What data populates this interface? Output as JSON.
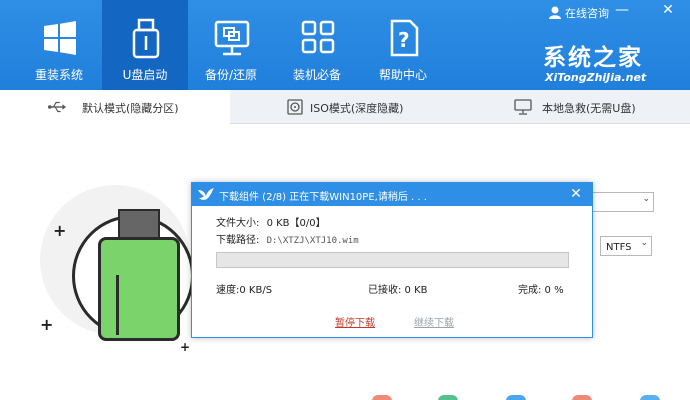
{
  "window": {
    "consult_label": "在线咨询",
    "minimize_label": "—",
    "close_label": "✕"
  },
  "brand": {
    "name_cn": "系统之家",
    "name_en": "XiTongZhiJia.net"
  },
  "nav": [
    {
      "label": "重装系统",
      "icon": "windows-logo-icon",
      "active": false
    },
    {
      "label": "U盘启动",
      "icon": "usb-drive-icon",
      "active": true
    },
    {
      "label": "备份/还原",
      "icon": "backup-restore-icon",
      "active": false
    },
    {
      "label": "装机必备",
      "icon": "apps-grid-icon",
      "active": false
    },
    {
      "label": "帮助中心",
      "icon": "help-document-icon",
      "active": false
    }
  ],
  "tabs": [
    {
      "label": "默认模式(隐藏分区)",
      "icon": "usb-symbol-icon",
      "active": true
    },
    {
      "label": "ISO模式(深度隐藏)",
      "icon": "disc-icon",
      "active": false
    },
    {
      "label": "本地急救(无需U盘)",
      "icon": "computer-icon",
      "active": false
    }
  ],
  "form": {
    "device_select_value": "",
    "format_select_value": "NTFS"
  },
  "dialog": {
    "title": "下载组件 (2/8) 正在下载WIN10PE,请稍后 . . .",
    "file_size_label": "文件大小:",
    "file_size_value": "0 KB【0/0】",
    "path_label": "下载路径:",
    "path_value": "D:\\XTZJ\\XTJ10.wim",
    "progress": 0,
    "speed_label": "速度:0 KB/S",
    "received_label": "已接收: 0 KB",
    "complete_label": "完成: 0 %",
    "pause_label": "暂停下载",
    "resume_label": "继续下载",
    "close_label": "✕"
  },
  "colors": {
    "header": "#2f8fe6",
    "active_nav": "#1366c2",
    "pause_link": "#c0392b",
    "resume_link_disabled": "#9aa3ad"
  }
}
